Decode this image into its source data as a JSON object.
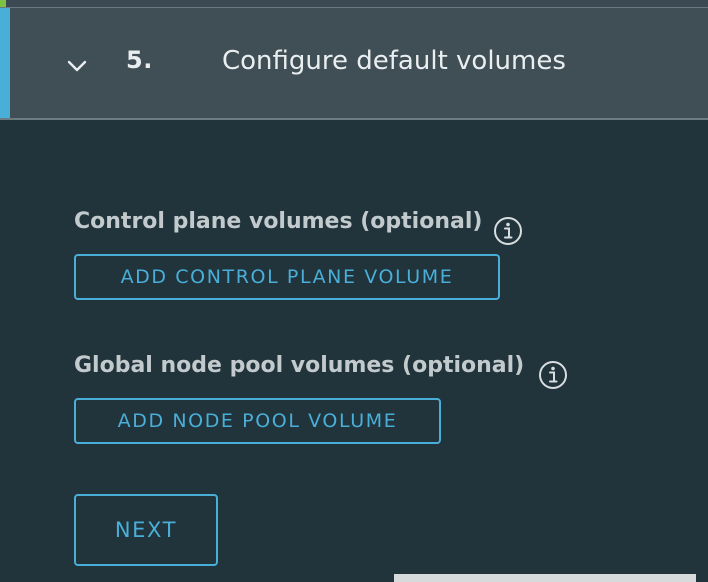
{
  "step": {
    "number": "5.",
    "title": "Configure default volumes",
    "expanded": true,
    "toggle_icon": "chevron-down-icon"
  },
  "control_plane": {
    "label": "Control plane volumes (optional)",
    "info_icon": "info-icon",
    "button_label": "ADD CONTROL PLANE VOLUME"
  },
  "node_pool": {
    "label": "Global node pool volumes (optional)",
    "info_icon": "info-icon",
    "button_label": "ADD NODE POOL VOLUME"
  },
  "actions": {
    "next_label": "NEXT"
  },
  "colors": {
    "background": "#21333b",
    "header_background": "#404e55",
    "accent": "#49afd9",
    "text_primary": "#e9eef0",
    "text_label": "#c2cacd",
    "success_strip": "#7bc243"
  }
}
